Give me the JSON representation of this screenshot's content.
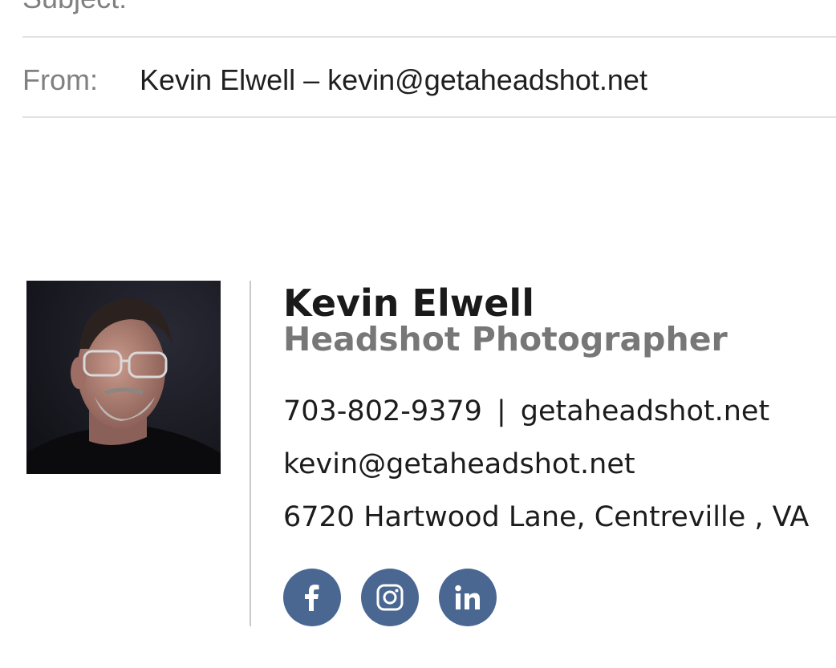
{
  "header": {
    "subject_label": "Subject:",
    "from_label": "From:",
    "from_value": "Kevin Elwell – kevin@getaheadshot.net"
  },
  "signature": {
    "name": "Kevin Elwell",
    "title": "Headshot Photographer",
    "phone": "703-802-9379",
    "separator": "|",
    "website": "getaheadshot.net",
    "email": "kevin@getaheadshot.net",
    "address": "6720 Hartwood Lane, Centreville , VA"
  },
  "social": {
    "items": [
      "facebook-icon",
      "instagram-icon",
      "linkedin-icon"
    ],
    "color": "#4a6791"
  },
  "colors": {
    "label_gray": "#808080",
    "title_gray": "#777777",
    "divider": "#e2e2e2"
  }
}
